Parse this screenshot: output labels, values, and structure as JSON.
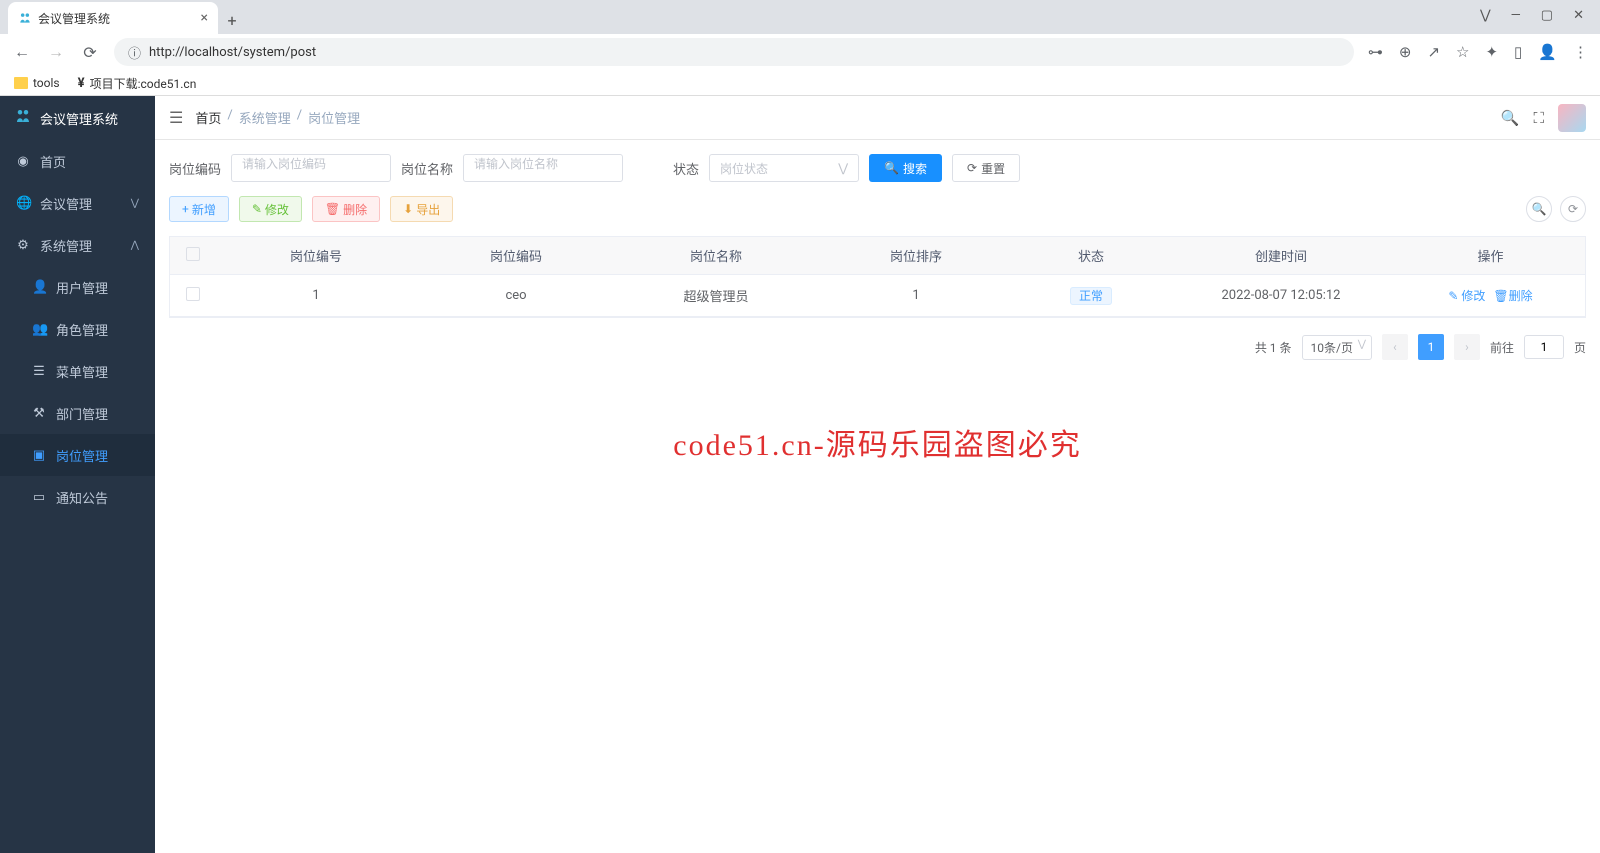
{
  "browser": {
    "tab_title": "会议管理系统",
    "url": "http://localhost/system/post",
    "bookmarks": [
      {
        "label": "tools"
      },
      {
        "label": "项目下载:code51.cn"
      }
    ]
  },
  "sidebar": {
    "app_name": "会议管理系统",
    "items": [
      {
        "label": "首页",
        "icon": "◉"
      },
      {
        "label": "会议管理",
        "icon": "🌐",
        "expandable": true
      },
      {
        "label": "系统管理",
        "icon": "⚙",
        "expandable": true,
        "expanded": true
      },
      {
        "label": "用户管理",
        "icon": "👤",
        "sub": true
      },
      {
        "label": "角色管理",
        "icon": "👥",
        "sub": true
      },
      {
        "label": "菜单管理",
        "icon": "☰",
        "sub": true
      },
      {
        "label": "部门管理",
        "icon": "⚒",
        "sub": true
      },
      {
        "label": "岗位管理",
        "icon": "▣",
        "sub": true,
        "active": true
      },
      {
        "label": "通知公告",
        "icon": "▭",
        "sub": true
      }
    ]
  },
  "breadcrumb": {
    "home": "首页",
    "l1": "系统管理",
    "l2": "岗位管理"
  },
  "search": {
    "code_label": "岗位编码",
    "code_placeholder": "请输入岗位编码",
    "name_label": "岗位名称",
    "name_placeholder": "请输入岗位名称",
    "status_label": "状态",
    "status_placeholder": "岗位状态",
    "search_btn": "搜索",
    "reset_btn": "重置"
  },
  "actions": {
    "add": "新增",
    "edit": "修改",
    "delete": "删除",
    "export": "导出"
  },
  "table": {
    "headers": {
      "id": "岗位编号",
      "code": "岗位编码",
      "name": "岗位名称",
      "sort": "岗位排序",
      "status": "状态",
      "created": "创建时间",
      "ops": "操作"
    },
    "row": {
      "id": "1",
      "code": "ceo",
      "name": "超级管理员",
      "sort": "1",
      "status": "正常",
      "created": "2022-08-07 12:05:12",
      "edit": "修改",
      "delete": "删除"
    }
  },
  "pagination": {
    "total": "共 1 条",
    "pagesize": "10条/页",
    "current": "1",
    "goto_prefix": "前往",
    "goto_val": "1",
    "goto_suffix": "页"
  },
  "watermark": "code51.cn-源码乐园盗图必究"
}
